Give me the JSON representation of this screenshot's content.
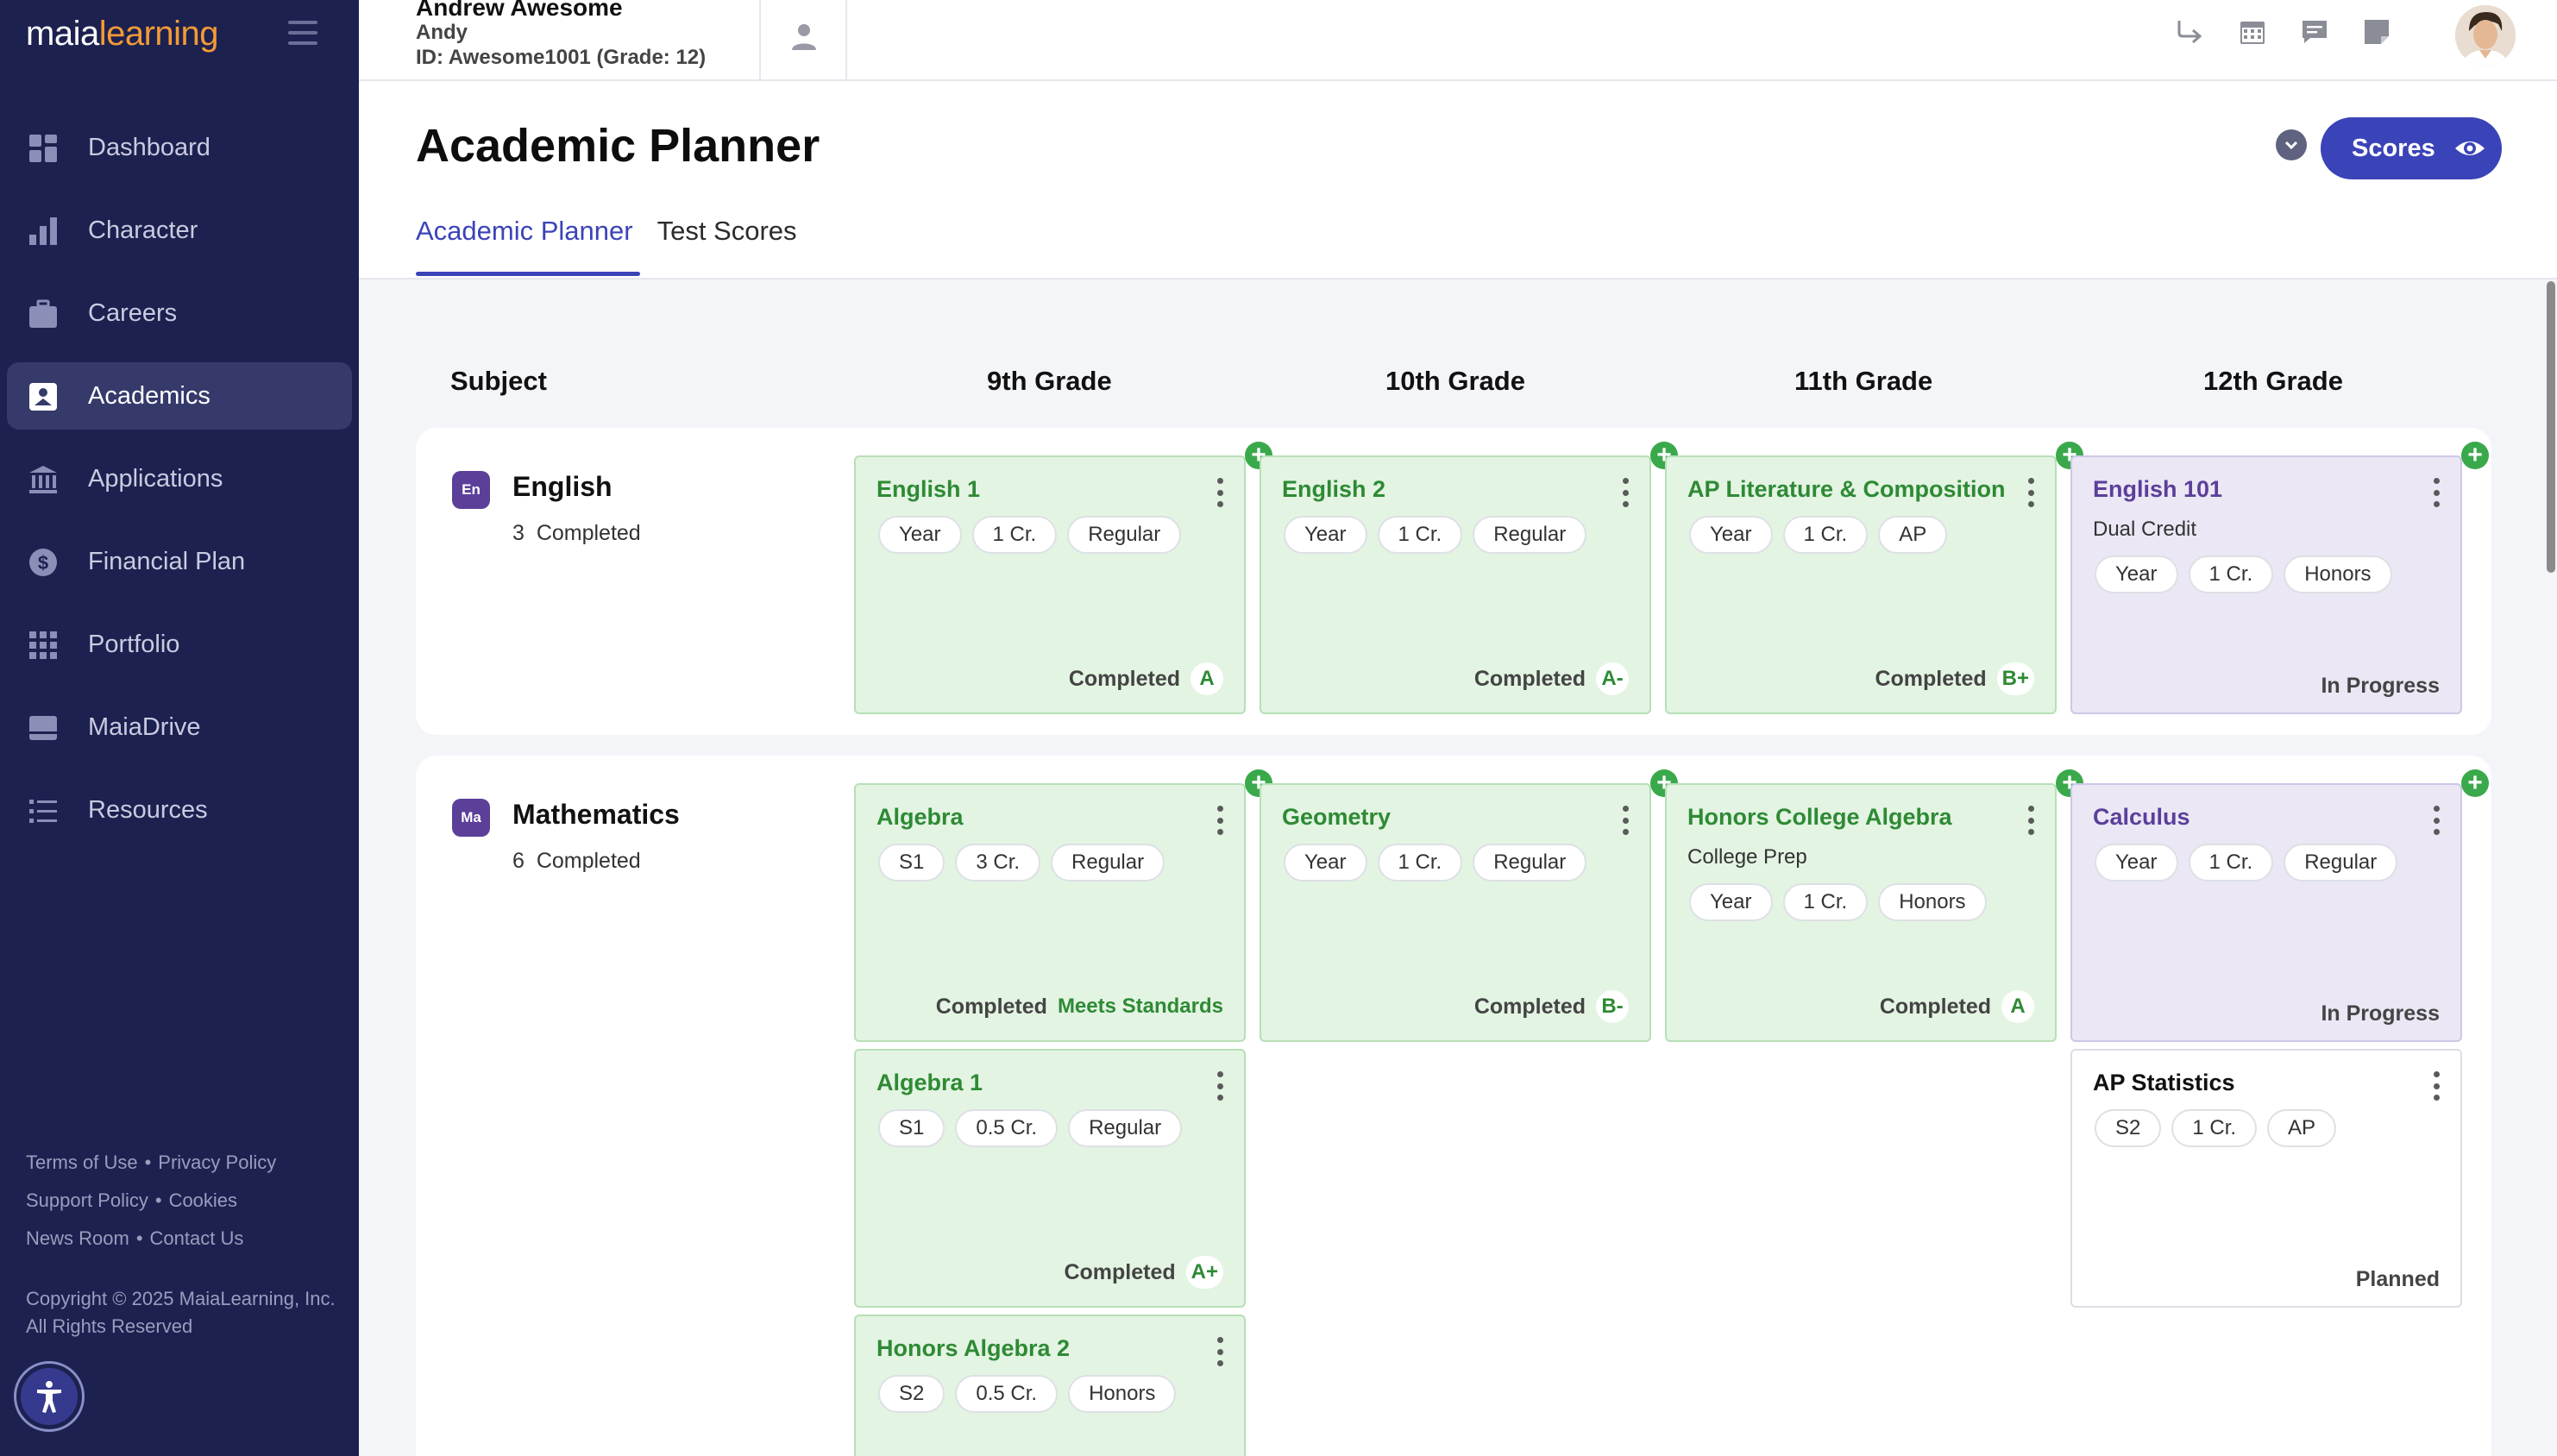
{
  "app": {
    "logo_part1": "maia",
    "logo_part2": "learning"
  },
  "sidebar": {
    "items": [
      {
        "label": "Dashboard",
        "icon": "dashboard-icon"
      },
      {
        "label": "Character",
        "icon": "bar-chart-icon"
      },
      {
        "label": "Careers",
        "icon": "briefcase-icon"
      },
      {
        "label": "Academics",
        "icon": "academics-icon",
        "active": true
      },
      {
        "label": "Applications",
        "icon": "institution-icon"
      },
      {
        "label": "Financial Plan",
        "icon": "dollar-icon"
      },
      {
        "label": "Portfolio",
        "icon": "grid-icon"
      },
      {
        "label": "MaiaDrive",
        "icon": "drive-icon"
      },
      {
        "label": "Resources",
        "icon": "list-icon"
      }
    ],
    "footer": {
      "terms": "Terms of Use",
      "privacy": "Privacy Policy",
      "support": "Support Policy",
      "cookies": "Cookies",
      "news": "News Room",
      "contact": "Contact Us",
      "copyright": "Copyright © 2025 MaiaLearning, Inc. All Rights Reserved"
    }
  },
  "header": {
    "student_name": "Andrew Awesome",
    "student_nickname": "Andy",
    "student_id": "ID: Awesome1001 (Grade: 12)"
  },
  "page": {
    "title": "Academic Planner",
    "scores_button": "Scores",
    "tabs": [
      "Academic Planner",
      "Test Scores"
    ],
    "active_tab": "Academic Planner"
  },
  "grid": {
    "columns": [
      "Subject",
      "9th Grade",
      "10th Grade",
      "11th Grade",
      "12th Grade"
    ]
  },
  "subjects": [
    {
      "badge": "En",
      "badge_color": "#5b3f99",
      "name": "English",
      "count": "3",
      "count_label": "Completed",
      "courses": [
        {
          "title": "English 1",
          "sub": "",
          "chips": [
            "Year",
            "1 Cr.",
            "Regular"
          ],
          "status": "Completed",
          "grade": "A",
          "style": "green"
        },
        {
          "title": "English 2",
          "sub": "",
          "chips": [
            "Year",
            "1 Cr.",
            "Regular"
          ],
          "status": "Completed",
          "grade": "A-",
          "style": "green"
        },
        {
          "title": "AP Literature & Composition",
          "sub": "",
          "chips": [
            "Year",
            "1 Cr.",
            "AP"
          ],
          "status": "Completed",
          "grade": "B+",
          "style": "green"
        },
        {
          "title": "English 101",
          "sub": "Dual Credit",
          "chips": [
            "Year",
            "1 Cr.",
            "Honors"
          ],
          "status": "In Progress",
          "grade": "",
          "style": "purple"
        }
      ]
    },
    {
      "badge": "Ma",
      "badge_color": "#5b3f99",
      "name": "Mathematics",
      "count": "6",
      "count_label": "Completed",
      "courses": [
        {
          "title": "Algebra",
          "sub": "",
          "chips": [
            "S1",
            "3 Cr.",
            "Regular"
          ],
          "status": "Completed",
          "grade": "Meets Standards",
          "style": "green"
        },
        {
          "title": "Geometry",
          "sub": "",
          "chips": [
            "Year",
            "1 Cr.",
            "Regular"
          ],
          "status": "Completed",
          "grade": "B-",
          "style": "green"
        },
        {
          "title": "Honors College Algebra",
          "sub": "College Prep",
          "chips": [
            "Year",
            "1 Cr.",
            "Honors"
          ],
          "status": "Completed",
          "grade": "A",
          "style": "green"
        },
        {
          "title": "Calculus",
          "sub": "",
          "chips": [
            "Year",
            "1 Cr.",
            "Regular"
          ],
          "status": "In Progress",
          "grade": "",
          "style": "purple"
        },
        {
          "title": "Algebra 1",
          "sub": "",
          "chips": [
            "S1",
            "0.5 Cr.",
            "Regular"
          ],
          "status": "Completed",
          "grade": "A+",
          "style": "green"
        },
        {
          "title": "AP Statistics",
          "sub": "",
          "chips": [
            "S2",
            "1 Cr.",
            "AP"
          ],
          "status": "Planned",
          "grade": "",
          "style": "white"
        },
        {
          "title": "Honors Algebra 2",
          "sub": "",
          "chips": [
            "S2",
            "0.5 Cr.",
            "Honors"
          ],
          "status": "",
          "grade": "",
          "style": "green"
        }
      ]
    }
  ]
}
